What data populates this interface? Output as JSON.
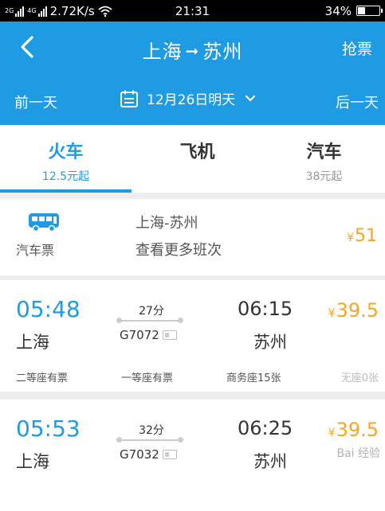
{
  "status_bar": {
    "network_badge": "2G",
    "network_badge2": "4G",
    "speed": "2.72K/s",
    "time": "21:31",
    "battery": "34%",
    "battery_level": 0.34
  },
  "header": {
    "from": "上海",
    "to": "苏州",
    "grab_label": "抢票",
    "prev_day": "前一天",
    "next_day": "后一天",
    "date": "12月26日明天"
  },
  "tabs": [
    {
      "name": "火车",
      "price": "12.5元起",
      "active": true
    },
    {
      "name": "飞机",
      "price": ""
    },
    {
      "name": "汽车",
      "price": "38元起"
    }
  ],
  "bus": {
    "label": "汽车票",
    "route": "上海-苏州",
    "more": "查看更多班次",
    "price": "51",
    "currency": "¥"
  },
  "trains": [
    {
      "dep_time": "05:48",
      "from": "上海",
      "duration": "27分",
      "number": "G7072",
      "arr_time": "06:15",
      "to": "苏州",
      "price": "39.5",
      "seats": [
        "二等座有票",
        "一等座有票",
        "商务座15张",
        "无座0张"
      ]
    },
    {
      "dep_time": "05:53",
      "from": "上海",
      "duration": "32分",
      "number": "G7032",
      "arr_time": "06:25",
      "to": "苏州",
      "price": "39.5",
      "seats": []
    }
  ],
  "colors": {
    "primary": "#1e9be3",
    "price": "#f5a623"
  },
  "watermark": "Bai 经验"
}
